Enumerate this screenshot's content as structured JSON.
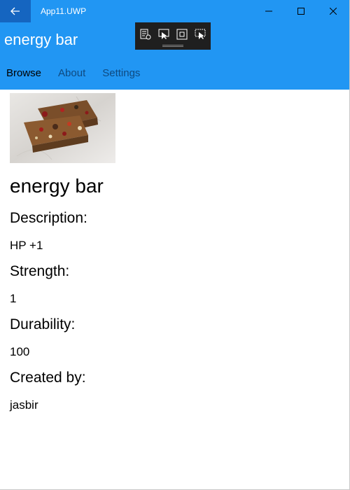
{
  "window": {
    "title": "App11.UWP"
  },
  "header": {
    "title": "energy bar",
    "tabs": [
      {
        "label": "Browse",
        "active": true
      },
      {
        "label": "About",
        "active": false
      },
      {
        "label": "Settings",
        "active": false
      }
    ]
  },
  "item": {
    "name": "energy bar",
    "description_label": "Description:",
    "description": "HP +1",
    "strength_label": "Strength:",
    "strength": "1",
    "durability_label": "Durability:",
    "durability": "100",
    "created_by_label": "Created by:",
    "created_by": "jasbir"
  },
  "colors": {
    "accent": "#2196f3",
    "back_button": "#1565c0",
    "inactive_tab": "#0f4a80",
    "debug_toolbar": "#1f1f1f"
  },
  "icons": {
    "back": "arrow-left-icon",
    "minimize": "minimize-icon",
    "maximize": "maximize-icon",
    "close": "close-icon",
    "debug": [
      "live-visual-tree-icon",
      "select-element-icon",
      "display-layout-adorners-icon",
      "track-focus-icon"
    ]
  }
}
